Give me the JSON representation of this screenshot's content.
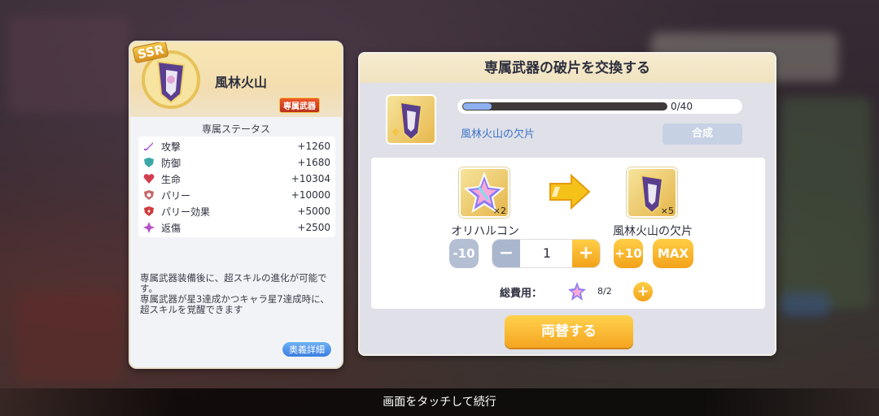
{
  "weapon_card": {
    "rarity": "SSR",
    "name": "風林火山",
    "badge": "専属武器",
    "stats_title": "専属ステータス",
    "stats": [
      {
        "name": "攻撃",
        "value": "+1260",
        "icon": "sword-icon",
        "color": "#b05ccf"
      },
      {
        "name": "防御",
        "value": "+1680",
        "icon": "shield-icon",
        "color": "#3ba8a8"
      },
      {
        "name": "生命",
        "value": "+10304",
        "icon": "heart-icon",
        "color": "#d23e4d"
      },
      {
        "name": "パリー",
        "value": "+10000",
        "icon": "parry-shield-icon",
        "color": "#c26a6a"
      },
      {
        "name": "パリー効果",
        "value": "+5000",
        "icon": "parry-effect-icon",
        "color": "#d03a3a"
      },
      {
        "name": "返傷",
        "value": "+2500",
        "icon": "reflect-icon",
        "color": "#b54fc6"
      }
    ],
    "description": "専属武器装備後に、超スキルの進化が可能です。\n専属武器が星3達成かつキャラ星7達成時に、超スキルを覚醒できます",
    "secret_button": "奥義詳細"
  },
  "dialog": {
    "title": "専属武器の破片を交換する",
    "progress_text": "0/40",
    "progress_fraction": 0.14,
    "shard_label": "風林火山の欠片",
    "synthesize_button": "合成",
    "cost_item": {
      "name": "オリハルコン",
      "qty": "×2",
      "icon": "star-crystal-icon"
    },
    "target_item": {
      "name": "風林火山の欠片",
      "qty": "×5",
      "icon": "weapon-shard-icon"
    },
    "minus10_label": "-10",
    "minus_label": "−",
    "quantity": "1",
    "plus_label": "+",
    "plus10_label": "+10",
    "max_label": "MAX",
    "total_label": "総費用：",
    "total_value": "8/2",
    "exchange_button": "両替する"
  },
  "footer": {
    "hint": "画面をタッチして続行"
  },
  "colors": {
    "accent": "#f5a520",
    "link_blue": "#3e74c9"
  }
}
